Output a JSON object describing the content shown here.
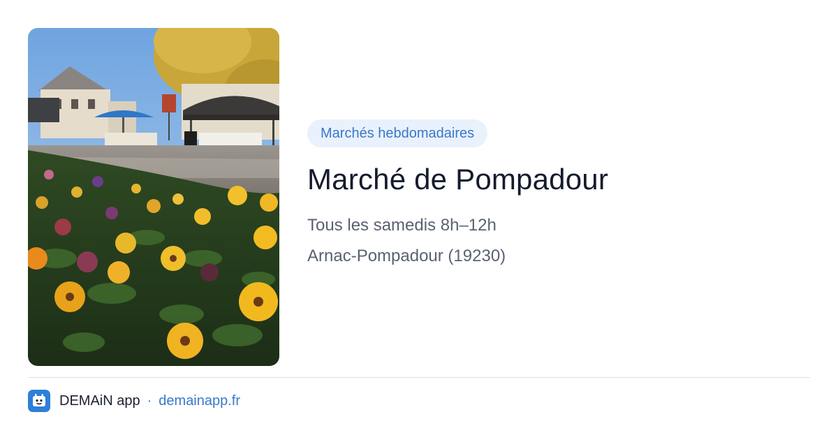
{
  "image": {
    "alt": "",
    "icon": "market-photo"
  },
  "badge": {
    "label": "Marchés hebdomadaires"
  },
  "title": "Marché de Pompadour",
  "schedule": "Tous les samedis 8h–12h",
  "location": "Arnac-Pompadour (19230)",
  "footer": {
    "app_name": "DEMAiN app",
    "separator": "·",
    "url": "demainapp.fr",
    "icon": "demain-app-icon"
  },
  "colors": {
    "badge_bg": "#e9f1fc",
    "accent": "#3a78c9",
    "title": "#141b2e",
    "muted": "#5a6272",
    "app_icon_bg": "#2d7fd8"
  }
}
